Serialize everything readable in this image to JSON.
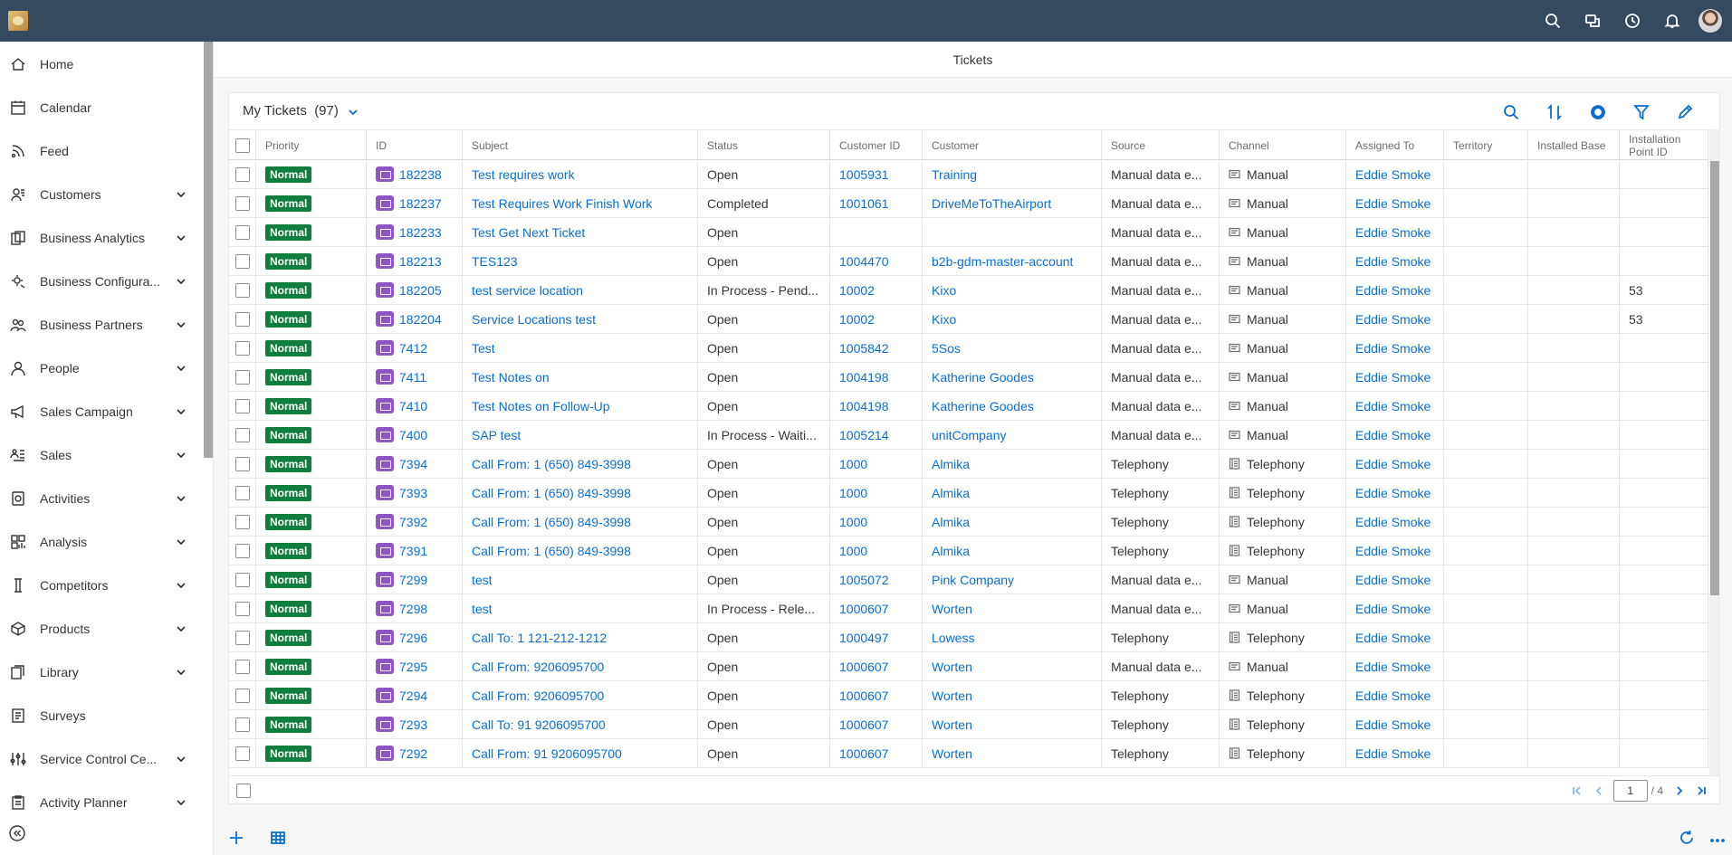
{
  "page_title": "Tickets",
  "sidebar": {
    "items": [
      {
        "label": "Home",
        "icon": "home-icon",
        "expandable": false
      },
      {
        "label": "Calendar",
        "icon": "calendar-icon",
        "expandable": false
      },
      {
        "label": "Feed",
        "icon": "feed-icon",
        "expandable": false
      },
      {
        "label": "Customers",
        "icon": "customers-icon",
        "expandable": true
      },
      {
        "label": "Business Analytics",
        "icon": "business-analytics-icon",
        "expandable": true
      },
      {
        "label": "Business Configura...",
        "icon": "business-configuration-icon",
        "expandable": true
      },
      {
        "label": "Business Partners",
        "icon": "business-partners-icon",
        "expandable": true
      },
      {
        "label": "People",
        "icon": "people-icon",
        "expandable": true
      },
      {
        "label": "Sales Campaign",
        "icon": "sales-campaign-icon",
        "expandable": true
      },
      {
        "label": "Sales",
        "icon": "sales-icon",
        "expandable": true
      },
      {
        "label": "Activities",
        "icon": "activities-icon",
        "expandable": true
      },
      {
        "label": "Analysis",
        "icon": "analysis-icon",
        "expandable": true
      },
      {
        "label": "Competitors",
        "icon": "competitors-icon",
        "expandable": true
      },
      {
        "label": "Products",
        "icon": "products-icon",
        "expandable": true
      },
      {
        "label": "Library",
        "icon": "library-icon",
        "expandable": true
      },
      {
        "label": "Surveys",
        "icon": "surveys-icon",
        "expandable": false
      },
      {
        "label": "Service Control Ce...",
        "icon": "service-control-icon",
        "expandable": true
      },
      {
        "label": "Activity Planner",
        "icon": "activity-planner-icon",
        "expandable": true
      }
    ]
  },
  "table": {
    "title": "My Tickets",
    "count": "(97)",
    "columns": [
      "Priority",
      "ID",
      "Subject",
      "Status",
      "Customer ID",
      "Customer",
      "Source",
      "Channel",
      "Assigned To",
      "Territory",
      "Installed Base",
      "Installation Point ID"
    ],
    "rows": [
      {
        "priority": "Normal",
        "id": "182238",
        "subject": "Test requires work",
        "status": "Open",
        "customer_id": "1005931",
        "customer": "Training",
        "source": "Manual data e...",
        "channel": "Manual",
        "assigned": "Eddie Smoke",
        "territory": "",
        "installed_base": "",
        "installation_point": ""
      },
      {
        "priority": "Normal",
        "id": "182237",
        "subject": "Test Requires Work Finish Work",
        "status": "Completed",
        "customer_id": "1001061",
        "customer": "DriveMeToTheAirport",
        "source": "Manual data e...",
        "channel": "Manual",
        "assigned": "Eddie Smoke",
        "territory": "",
        "installed_base": "",
        "installation_point": ""
      },
      {
        "priority": "Normal",
        "id": "182233",
        "subject": "Test Get Next Ticket",
        "status": "Open",
        "customer_id": "",
        "customer": "",
        "source": "Manual data e...",
        "channel": "Manual",
        "assigned": "Eddie Smoke",
        "territory": "",
        "installed_base": "",
        "installation_point": ""
      },
      {
        "priority": "Normal",
        "id": "182213",
        "subject": "TES123",
        "status": "Open",
        "customer_id": "1004470",
        "customer": "b2b-gdm-master-account",
        "source": "Manual data e...",
        "channel": "Manual",
        "assigned": "Eddie Smoke",
        "territory": "",
        "installed_base": "",
        "installation_point": ""
      },
      {
        "priority": "Normal",
        "id": "182205",
        "subject": "test service location",
        "status": "In Process - Pend...",
        "customer_id": "10002",
        "customer": "Kixo",
        "source": "Manual data e...",
        "channel": "Manual",
        "assigned": "Eddie Smoke",
        "territory": "",
        "installed_base": "",
        "installation_point": "53"
      },
      {
        "priority": "Normal",
        "id": "182204",
        "subject": "Service Locations test",
        "status": "Open",
        "customer_id": "10002",
        "customer": "Kixo",
        "source": "Manual data e...",
        "channel": "Manual",
        "assigned": "Eddie Smoke",
        "territory": "",
        "installed_base": "",
        "installation_point": "53"
      },
      {
        "priority": "Normal",
        "id": "7412",
        "subject": "Test",
        "status": "Open",
        "customer_id": "1005842",
        "customer": "5Sos",
        "source": "Manual data e...",
        "channel": "Manual",
        "assigned": "Eddie Smoke",
        "territory": "",
        "installed_base": "",
        "installation_point": ""
      },
      {
        "priority": "Normal",
        "id": "7411",
        "subject": "Test Notes on",
        "status": "Open",
        "customer_id": "1004198",
        "customer": "Katherine Goodes",
        "source": "Manual data e...",
        "channel": "Manual",
        "assigned": "Eddie Smoke",
        "territory": "",
        "installed_base": "",
        "installation_point": ""
      },
      {
        "priority": "Normal",
        "id": "7410",
        "subject": "Test Notes on Follow-Up",
        "status": "Open",
        "customer_id": "1004198",
        "customer": "Katherine Goodes",
        "source": "Manual data e...",
        "channel": "Manual",
        "assigned": "Eddie Smoke",
        "territory": "",
        "installed_base": "",
        "installation_point": ""
      },
      {
        "priority": "Normal",
        "id": "7400",
        "subject": "SAP test",
        "status": "In Process - Waiti...",
        "customer_id": "1005214",
        "customer": "unitCompany",
        "source": "Manual data e...",
        "channel": "Manual",
        "assigned": "Eddie Smoke",
        "territory": "",
        "installed_base": "",
        "installation_point": ""
      },
      {
        "priority": "Normal",
        "id": "7394",
        "subject": "Call From: 1 (650) 849-3998",
        "status": "Open",
        "customer_id": "1000",
        "customer": "Almika",
        "source": "Telephony",
        "channel": "Telephony",
        "assigned": "Eddie Smoke",
        "territory": "",
        "installed_base": "",
        "installation_point": ""
      },
      {
        "priority": "Normal",
        "id": "7393",
        "subject": "Call From: 1 (650) 849-3998",
        "status": "Open",
        "customer_id": "1000",
        "customer": "Almika",
        "source": "Telephony",
        "channel": "Telephony",
        "assigned": "Eddie Smoke",
        "territory": "",
        "installed_base": "",
        "installation_point": ""
      },
      {
        "priority": "Normal",
        "id": "7392",
        "subject": "Call From: 1 (650) 849-3998",
        "status": "Open",
        "customer_id": "1000",
        "customer": "Almika",
        "source": "Telephony",
        "channel": "Telephony",
        "assigned": "Eddie Smoke",
        "territory": "",
        "installed_base": "",
        "installation_point": ""
      },
      {
        "priority": "Normal",
        "id": "7391",
        "subject": "Call From: 1 (650) 849-3998",
        "status": "Open",
        "customer_id": "1000",
        "customer": "Almika",
        "source": "Telephony",
        "channel": "Telephony",
        "assigned": "Eddie Smoke",
        "territory": "",
        "installed_base": "",
        "installation_point": ""
      },
      {
        "priority": "Normal",
        "id": "7299",
        "subject": "test",
        "status": "Open",
        "customer_id": "1005072",
        "customer": "Pink Company",
        "source": "Manual data e...",
        "channel": "Manual",
        "assigned": "Eddie Smoke",
        "territory": "",
        "installed_base": "",
        "installation_point": ""
      },
      {
        "priority": "Normal",
        "id": "7298",
        "subject": "test",
        "status": "In Process - Rele...",
        "customer_id": "1000607",
        "customer": "Worten",
        "source": "Manual data e...",
        "channel": "Manual",
        "assigned": "Eddie Smoke",
        "territory": "",
        "installed_base": "",
        "installation_point": ""
      },
      {
        "priority": "Normal",
        "id": "7296",
        "subject": "Call To: 1 121-212-1212",
        "status": "Open",
        "customer_id": "1000497",
        "customer": "Lowess",
        "source": "Telephony",
        "channel": "Telephony",
        "assigned": "Eddie Smoke",
        "territory": "",
        "installed_base": "",
        "installation_point": ""
      },
      {
        "priority": "Normal",
        "id": "7295",
        "subject": "Call From: 9206095700",
        "status": "Open",
        "customer_id": "1000607",
        "customer": "Worten",
        "source": "Manual data e...",
        "channel": "Manual",
        "assigned": "Eddie Smoke",
        "territory": "",
        "installed_base": "",
        "installation_point": ""
      },
      {
        "priority": "Normal",
        "id": "7294",
        "subject": "Call From: 9206095700",
        "status": "Open",
        "customer_id": "1000607",
        "customer": "Worten",
        "source": "Telephony",
        "channel": "Telephony",
        "assigned": "Eddie Smoke",
        "territory": "",
        "installed_base": "",
        "installation_point": ""
      },
      {
        "priority": "Normal",
        "id": "7293",
        "subject": "Call To: 91 9206095700",
        "status": "Open",
        "customer_id": "1000607",
        "customer": "Worten",
        "source": "Telephony",
        "channel": "Telephony",
        "assigned": "Eddie Smoke",
        "territory": "",
        "installed_base": "",
        "installation_point": ""
      },
      {
        "priority": "Normal",
        "id": "7292",
        "subject": "Call From: 91 9206095700",
        "status": "Open",
        "customer_id": "1000607",
        "customer": "Worten",
        "source": "Telephony",
        "channel": "Telephony",
        "assigned": "Eddie Smoke",
        "territory": "",
        "installed_base": "",
        "installation_point": ""
      }
    ]
  },
  "pager": {
    "current": "1",
    "total": "/ 4"
  },
  "colors": {
    "shell": "#354a5f",
    "accent": "#0a6ed1",
    "badge_green": "#107e3e",
    "ticket_purple": "#8f55c5"
  }
}
